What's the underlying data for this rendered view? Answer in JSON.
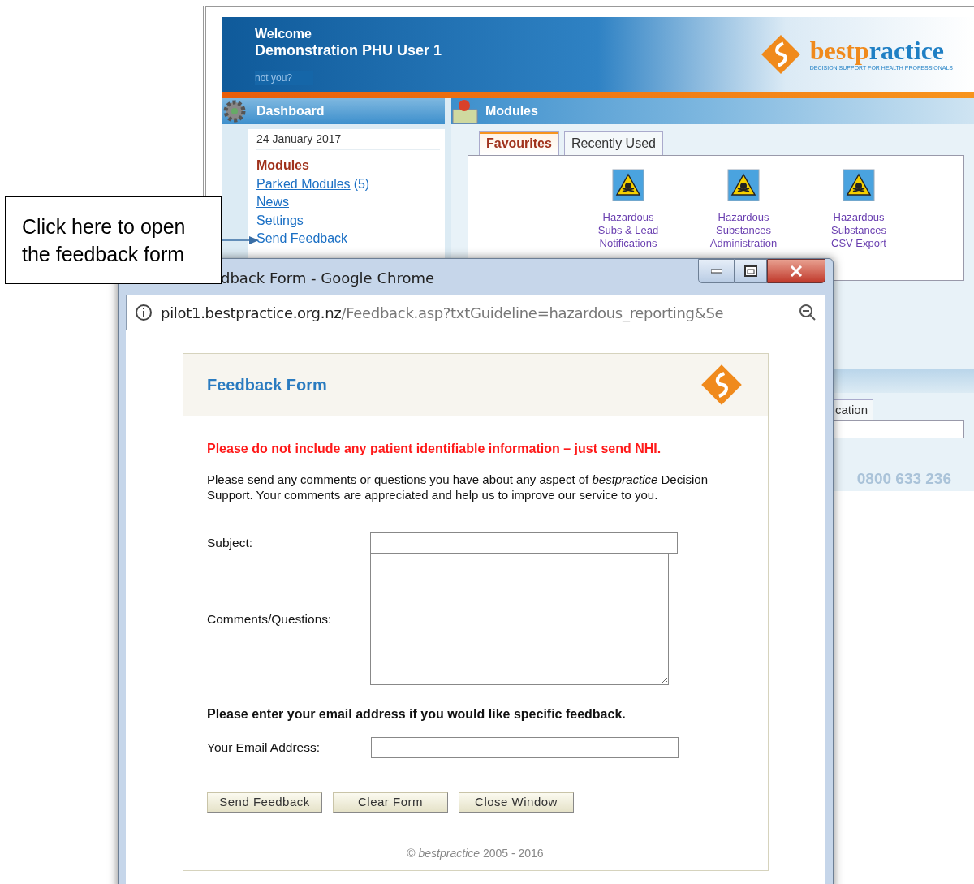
{
  "header": {
    "welcome": "Welcome",
    "user": "Demonstration PHU User 1",
    "not_you": "not you?",
    "logo_parts": [
      {
        "text": "best",
        "color": "#f08a1c"
      },
      {
        "text": "p",
        "color": "#f08a1c"
      },
      {
        "text": "ractice",
        "color": "#1f7fc4"
      }
    ],
    "tagline": "DECISION SUPPORT FOR HEALTH PROFESSIONALS"
  },
  "dashboard": {
    "title": "Dashboard",
    "date": "24 January 2017",
    "section": "Modules",
    "links": [
      {
        "label": "Parked Modules",
        "count": "(5)"
      },
      {
        "label": "News"
      },
      {
        "label": "Settings"
      },
      {
        "label": "Send Feedback"
      }
    ]
  },
  "modules": {
    "title": "Modules",
    "tabs": [
      {
        "label": "Favourites",
        "selected": true
      },
      {
        "label": "Recently Used",
        "selected": false
      }
    ],
    "items": [
      {
        "label": "Hazardous\nSubs & Lead\nNotifications"
      },
      {
        "label": "Hazardous\nSubstances\nAdministration"
      },
      {
        "label": "Hazardous\nSubstances\nCSV Export"
      }
    ]
  },
  "lower_panel": {
    "tab": "cation",
    "phone": "0800 633 236"
  },
  "callout": {
    "text": "Click here to open the feedback form"
  },
  "popup": {
    "title": "dback Form - Google Chrome",
    "url_host": "pilot1.bestpractice.org.nz",
    "url_path": "/Feedback.asp?txtGuideline=hazardous_reporting&Se",
    "form": {
      "title": "Feedback Form",
      "warning": "Please do not include any patient identifiable information – just send NHI.",
      "intro": "Please send any comments or questions you have about any aspect of *bestpractice* Decision Support. Your comments are appreciated and help us to improve our service to you.",
      "subject_label": "Subject:",
      "comments_label": "Comments/Questions:",
      "email_prompt": "Please enter your email address if you would like specific feedback.",
      "email_label": "Your Email Address:",
      "buttons": [
        "Send Feedback",
        "Clear Form",
        "Close Window"
      ],
      "footer": "© *bestpractice* 2005 - 2016"
    }
  }
}
